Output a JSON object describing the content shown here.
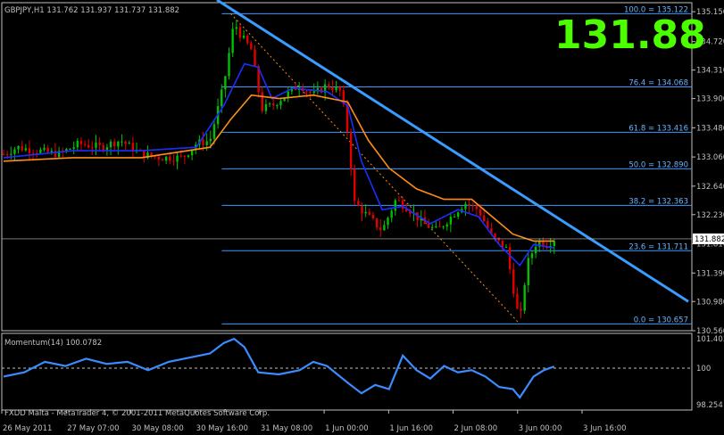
{
  "window": {
    "header": "GBPJPY,H1  131.762 131.937 131.737 131.882",
    "big_price": "131.88",
    "copyright": "FXDD Malta - MetaTrader 4, © 2001-2011 MetaQuotes Software Corp.",
    "current_price_tag": "131.882"
  },
  "colors": {
    "background": "#000000",
    "bull_candle": "#00c000",
    "bear_candle": "#e00000",
    "fast_ma": "#1a2eff",
    "slow_ma": "#ff8c1a",
    "trendline": "#3a9cff",
    "fib_levels": "#3a9cff",
    "momentum": "#3a8cff",
    "big_price": "#4cff00"
  },
  "chart_data": [
    {
      "type": "candlestick",
      "symbol": "GBPJPY",
      "timeframe": "H1",
      "ylim": [
        130.56,
        135.28
      ],
      "yticks": [
        135.15,
        134.72,
        134.31,
        133.9,
        133.48,
        133.06,
        132.64,
        132.23,
        131.81,
        131.39,
        130.98,
        130.56
      ],
      "ytick_labels": [
        "135.150",
        "134.720",
        "134.310",
        "133.900",
        "133.480",
        "133.060",
        "132.640",
        "132.230",
        "131.810",
        "131.390",
        "130.980",
        "130.560"
      ],
      "xtick_labels": [
        "26 May 2011",
        "27 May 07:00",
        "30 May 08:00",
        "30 May 16:00",
        "31 May 08:00",
        "1 Jun 00:00",
        "1 Jun 16:00",
        "2 Jun 08:00",
        "3 Jun 00:00",
        "3 Jun 16:00"
      ],
      "close_path": [
        {
          "t": 0,
          "v": 133.1
        },
        {
          "t": 0.02,
          "v": 133.2
        },
        {
          "t": 0.05,
          "v": 133.15
        },
        {
          "t": 0.08,
          "v": 133.1
        },
        {
          "t": 0.11,
          "v": 133.25
        },
        {
          "t": 0.14,
          "v": 133.2
        },
        {
          "t": 0.17,
          "v": 133.3
        },
        {
          "t": 0.2,
          "v": 133.1
        },
        {
          "t": 0.23,
          "v": 133.05
        },
        {
          "t": 0.26,
          "v": 133.05
        },
        {
          "t": 0.28,
          "v": 133.25
        },
        {
          "t": 0.3,
          "v": 133.3
        },
        {
          "t": 0.32,
          "v": 134.1
        },
        {
          "t": 0.335,
          "v": 135.0
        },
        {
          "t": 0.345,
          "v": 134.8
        },
        {
          "t": 0.36,
          "v": 134.6
        },
        {
          "t": 0.375,
          "v": 133.75
        },
        {
          "t": 0.39,
          "v": 133.8
        },
        {
          "t": 0.41,
          "v": 133.95
        },
        {
          "t": 0.43,
          "v": 134.1
        },
        {
          "t": 0.45,
          "v": 133.95
        },
        {
          "t": 0.47,
          "v": 134.1
        },
        {
          "t": 0.49,
          "v": 134.0
        },
        {
          "t": 0.5,
          "v": 133.4
        },
        {
          "t": 0.51,
          "v": 132.4
        },
        {
          "t": 0.53,
          "v": 132.2
        },
        {
          "t": 0.55,
          "v": 132.0
        },
        {
          "t": 0.57,
          "v": 132.45
        },
        {
          "t": 0.59,
          "v": 132.3
        },
        {
          "t": 0.61,
          "v": 132.1
        },
        {
          "t": 0.63,
          "v": 132.0
        },
        {
          "t": 0.65,
          "v": 132.2
        },
        {
          "t": 0.67,
          "v": 132.4
        },
        {
          "t": 0.69,
          "v": 132.3
        },
        {
          "t": 0.71,
          "v": 131.9
        },
        {
          "t": 0.73,
          "v": 131.75
        },
        {
          "t": 0.74,
          "v": 131.2
        },
        {
          "t": 0.75,
          "v": 130.65
        },
        {
          "t": 0.76,
          "v": 131.5
        },
        {
          "t": 0.775,
          "v": 131.85
        },
        {
          "t": 0.79,
          "v": 131.8
        },
        {
          "t": 0.8,
          "v": 131.88
        }
      ],
      "moving_averages": [
        {
          "role": "fast",
          "path": [
            {
              "t": 0,
              "v": 133.05
            },
            {
              "t": 0.1,
              "v": 133.15
            },
            {
              "t": 0.2,
              "v": 133.15
            },
            {
              "t": 0.28,
              "v": 133.2
            },
            {
              "t": 0.32,
              "v": 133.8
            },
            {
              "t": 0.35,
              "v": 134.4
            },
            {
              "t": 0.37,
              "v": 134.35
            },
            {
              "t": 0.39,
              "v": 133.9
            },
            {
              "t": 0.42,
              "v": 134.05
            },
            {
              "t": 0.47,
              "v": 134.0
            },
            {
              "t": 0.5,
              "v": 133.8
            },
            {
              "t": 0.52,
              "v": 133.0
            },
            {
              "t": 0.55,
              "v": 132.3
            },
            {
              "t": 0.58,
              "v": 132.35
            },
            {
              "t": 0.62,
              "v": 132.1
            },
            {
              "t": 0.66,
              "v": 132.3
            },
            {
              "t": 0.69,
              "v": 132.2
            },
            {
              "t": 0.72,
              "v": 131.8
            },
            {
              "t": 0.75,
              "v": 131.5
            },
            {
              "t": 0.77,
              "v": 131.8
            },
            {
              "t": 0.8,
              "v": 131.75
            }
          ]
        },
        {
          "role": "slow",
          "path": [
            {
              "t": 0,
              "v": 133.0
            },
            {
              "t": 0.1,
              "v": 133.05
            },
            {
              "t": 0.2,
              "v": 133.05
            },
            {
              "t": 0.3,
              "v": 133.2
            },
            {
              "t": 0.33,
              "v": 133.6
            },
            {
              "t": 0.36,
              "v": 133.95
            },
            {
              "t": 0.4,
              "v": 133.9
            },
            {
              "t": 0.45,
              "v": 133.95
            },
            {
              "t": 0.5,
              "v": 133.85
            },
            {
              "t": 0.53,
              "v": 133.3
            },
            {
              "t": 0.56,
              "v": 132.9
            },
            {
              "t": 0.6,
              "v": 132.6
            },
            {
              "t": 0.64,
              "v": 132.45
            },
            {
              "t": 0.68,
              "v": 132.45
            },
            {
              "t": 0.71,
              "v": 132.2
            },
            {
              "t": 0.74,
              "v": 131.95
            },
            {
              "t": 0.77,
              "v": 131.85
            },
            {
              "t": 0.8,
              "v": 131.85
            }
          ]
        }
      ],
      "fibonacci": {
        "levels": [
          {
            "label": "100.0 = 135.122",
            "price": 135.122
          },
          {
            "label": "76.4 = 134.068",
            "price": 134.068
          },
          {
            "label": "61.8 = 133.416",
            "price": 133.416
          },
          {
            "label": "50.0 = 132.890",
            "price": 132.89
          },
          {
            "label": "38.2 = 132.363",
            "price": 132.363
          },
          {
            "label": "23.6 = 131.711",
            "price": 131.711
          },
          {
            "label": "0.0 = 130.657",
            "price": 130.657
          }
        ],
        "anchor_high": {
          "t": 0.33,
          "v": 135.122
        },
        "anchor_low": {
          "t": 0.75,
          "v": 130.657
        }
      },
      "trendline": {
        "start": {
          "t": 0.31,
          "v": 135.32
        },
        "end": {
          "t": 1.0,
          "v": 130.98
        }
      },
      "current_price": 131.882
    },
    {
      "type": "line",
      "indicator": "Momentum(14)",
      "title": "Momentum(14) 100.0782",
      "last_value": 100.0782,
      "ylim": [
        98.254,
        101.403
      ],
      "yticks": [
        101.403,
        100,
        98.254
      ],
      "ytick_labels": [
        "101.403",
        "100",
        "98.254"
      ],
      "reference_level": 100,
      "path": [
        {
          "t": 0,
          "v": 99.6
        },
        {
          "t": 0.03,
          "v": 99.8
        },
        {
          "t": 0.06,
          "v": 100.3
        },
        {
          "t": 0.09,
          "v": 100.1
        },
        {
          "t": 0.12,
          "v": 100.45
        },
        {
          "t": 0.15,
          "v": 100.2
        },
        {
          "t": 0.18,
          "v": 100.3
        },
        {
          "t": 0.21,
          "v": 99.9
        },
        {
          "t": 0.24,
          "v": 100.3
        },
        {
          "t": 0.27,
          "v": 100.5
        },
        {
          "t": 0.3,
          "v": 100.7
        },
        {
          "t": 0.32,
          "v": 101.2
        },
        {
          "t": 0.335,
          "v": 101.4
        },
        {
          "t": 0.35,
          "v": 101.0
        },
        {
          "t": 0.37,
          "v": 99.8
        },
        {
          "t": 0.4,
          "v": 99.7
        },
        {
          "t": 0.43,
          "v": 99.9
        },
        {
          "t": 0.45,
          "v": 100.3
        },
        {
          "t": 0.47,
          "v": 100.1
        },
        {
          "t": 0.5,
          "v": 99.3
        },
        {
          "t": 0.52,
          "v": 98.8
        },
        {
          "t": 0.54,
          "v": 99.2
        },
        {
          "t": 0.56,
          "v": 99.0
        },
        {
          "t": 0.58,
          "v": 100.6
        },
        {
          "t": 0.6,
          "v": 99.9
        },
        {
          "t": 0.62,
          "v": 99.5
        },
        {
          "t": 0.64,
          "v": 100.1
        },
        {
          "t": 0.66,
          "v": 99.8
        },
        {
          "t": 0.68,
          "v": 99.9
        },
        {
          "t": 0.7,
          "v": 99.6
        },
        {
          "t": 0.72,
          "v": 99.1
        },
        {
          "t": 0.74,
          "v": 99.0
        },
        {
          "t": 0.75,
          "v": 98.6
        },
        {
          "t": 0.77,
          "v": 99.6
        },
        {
          "t": 0.785,
          "v": 99.9
        },
        {
          "t": 0.8,
          "v": 100.08
        }
      ]
    }
  ]
}
